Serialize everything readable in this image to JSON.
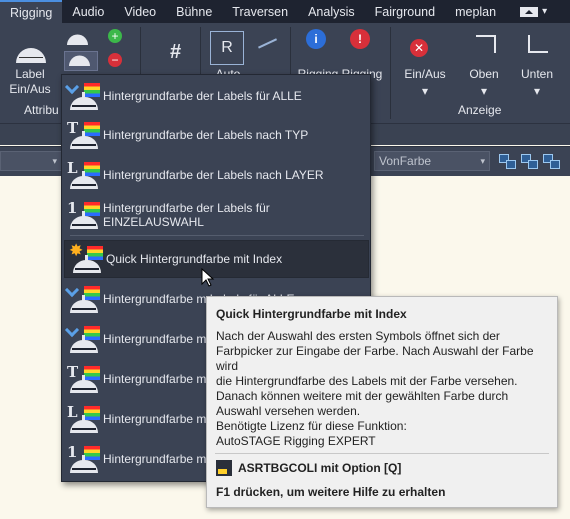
{
  "menubar": {
    "tabs": [
      "Rigging",
      "Audio",
      "Video",
      "Bühne",
      "Traversen",
      "Analysis",
      "Fairground",
      "meplan"
    ],
    "active_tab": "Rigging"
  },
  "ribbon": {
    "label_btn": "Label\nEin/Aus",
    "attrib_group_label": "Attribu",
    "auto_label": "Auto",
    "rigging_label": "Rigging",
    "rigging2_label": "Rigging",
    "einaus_label": "Ein/Aus",
    "oben_label": "Oben",
    "unten_label": "Unten",
    "anzeige_group_label": "Anzeige"
  },
  "status_strip": {
    "color_select": "VonFarbe"
  },
  "dropdown": {
    "items": [
      {
        "label": "Hintergrundfarbe der Labels für ALLE",
        "icon": "label-all-icon"
      },
      {
        "label": "Hintergrundfarbe der Labels nach TYP",
        "icon": "label-type-icon"
      },
      {
        "label": "Hintergrundfarbe der Labels nach LAYER",
        "icon": "label-layer-icon"
      },
      {
        "label": "Hintergrundfarbe der Labels für EINZELAUSWAHL",
        "icon": "label-single-icon"
      },
      {
        "label": "Quick Hintergrundfarbe mit Index",
        "icon": "quick-index-icon"
      },
      {
        "label": "Hintergrundfarbe m Labels für ALLE",
        "icon": "label-all-icon"
      },
      {
        "label": "Hintergrundfarbe m",
        "icon": "label-all-icon"
      },
      {
        "label": "Hintergrundfarbe m",
        "icon": "label-type-icon"
      },
      {
        "label": "Hintergrundfarbe m",
        "icon": "label-layer-icon"
      },
      {
        "label": "Hintergrundfarbe m",
        "icon": "label-single-icon"
      }
    ]
  },
  "tooltip": {
    "title": "Quick Hintergrundfarbe mit Index",
    "body": "Nach der Auswahl des ersten Symbols öffnet sich der\nFarbpicker zur Eingabe der Farbe. Nach Auswahl der Farbe wird\ndie Hintergrundfarbe des Labels mit der Farbe versehen.\nDanach können weitere mit der gewählten Farbe durch\nAuswahl versehen werden.",
    "license": "Benötigte Lizenz für diese Funktion:\nAutoSTAGE Rigging EXPERT",
    "command": "ASRTBGCOLI mit Option [Q]",
    "help": "F1 drücken, um weitere Hilfe zu erhalten"
  }
}
